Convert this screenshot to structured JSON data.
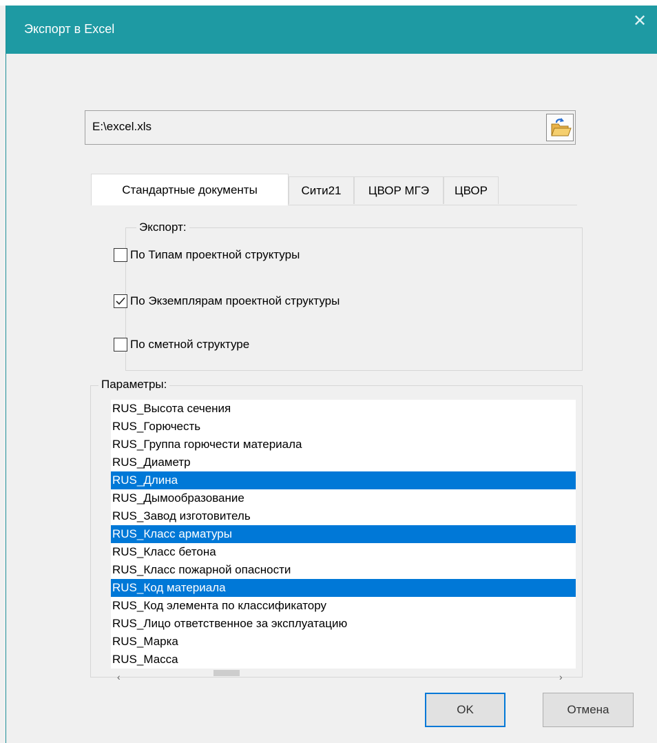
{
  "window": {
    "title": "Экспорт в Excel",
    "close_glyph": "✕"
  },
  "file": {
    "path": "E:\\excel.xls",
    "browse_icon": "folder-open-icon"
  },
  "tabs": [
    {
      "label": "Стандартные документы",
      "active": true
    },
    {
      "label": "Сити21",
      "active": false
    },
    {
      "label": "ЦВОР МГЭ",
      "active": false
    },
    {
      "label": "ЦВОР",
      "active": false
    }
  ],
  "export_group": {
    "label": "Экспорт:",
    "options": [
      {
        "label": "По Типам проектной структуры",
        "checked": false
      },
      {
        "label": "По Экземплярам проектной структуры",
        "checked": true
      },
      {
        "label": "По сметной структуре",
        "checked": false
      }
    ]
  },
  "params_group": {
    "label": "Параметры:",
    "items": [
      {
        "label": "RUS_Высота сечения",
        "selected": false
      },
      {
        "label": "RUS_Горючесть",
        "selected": false
      },
      {
        "label": "RUS_Группа горючести материала",
        "selected": false
      },
      {
        "label": "RUS_Диаметр",
        "selected": false
      },
      {
        "label": "RUS_Длина",
        "selected": true
      },
      {
        "label": "RUS_Дымообразование",
        "selected": false
      },
      {
        "label": "RUS_Завод изготовитель",
        "selected": false
      },
      {
        "label": "RUS_Класс арматуры",
        "selected": true
      },
      {
        "label": "RUS_Класс бетона",
        "selected": false
      },
      {
        "label": "RUS_Класс пожарной опасности",
        "selected": false
      },
      {
        "label": "RUS_Код материала",
        "selected": true
      },
      {
        "label": "RUS_Код элемента по классификатору",
        "selected": false
      },
      {
        "label": "RUS_Лицо ответственное за эксплуатацию",
        "selected": false
      },
      {
        "label": "RUS_Марка",
        "selected": false
      },
      {
        "label": "RUS_Масса",
        "selected": false
      }
    ]
  },
  "buttons": {
    "ok": "OK",
    "cancel": "Отмена"
  },
  "colors": {
    "titlebar": "#1e9aa3",
    "selection": "#0078d7",
    "default_button_border": "#0078d7"
  }
}
